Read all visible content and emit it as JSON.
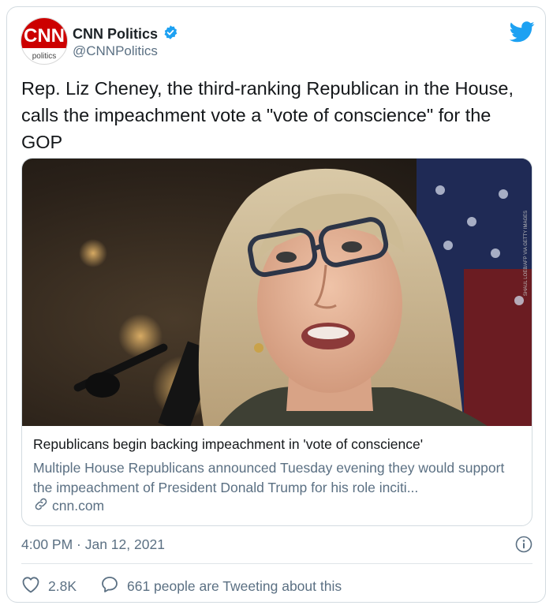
{
  "author": {
    "name": "CNN Politics",
    "handle": "@CNNPolitics",
    "avatar_logo": "CNN",
    "avatar_sub": "politics",
    "verified": true
  },
  "tweet": {
    "text": "Rep. Liz Cheney, the third-ranking Republican in the House, calls the impeachment vote a \"vote of conscience\" for the GOP"
  },
  "card": {
    "title": "Republicans begin backing impeachment in 'vote of conscience'",
    "description": "Multiple House Republicans announced Tuesday evening they would support the impeachment of President Donald Trump for his role inciti...",
    "domain": "cnn.com",
    "image_credit": "SHAUL LOEB/AFP VIA GETTY IMAGES"
  },
  "meta": {
    "timestamp": "4:00 PM · Jan 12, 2021"
  },
  "actions": {
    "likes": "2.8K",
    "conversation": "661 people are Tweeting about this"
  },
  "colors": {
    "twitter_blue": "#1da1f2",
    "cnn_red": "#cc0000",
    "secondary_text": "#5b7083",
    "border": "#d3dbe0"
  },
  "icons": {
    "brand": "twitter-bird-icon",
    "verified": "verified-badge-icon",
    "info": "info-icon",
    "link": "link-icon",
    "like": "heart-icon",
    "reply": "speech-bubble-icon"
  }
}
